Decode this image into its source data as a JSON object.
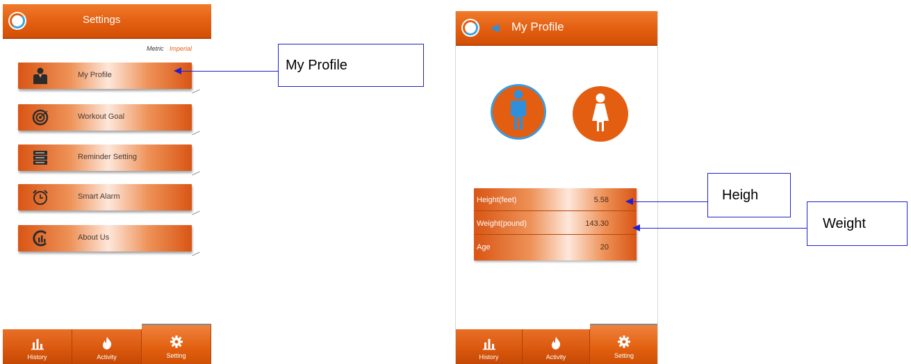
{
  "settings_screen": {
    "title": "Settings",
    "units": {
      "metric": "Metric",
      "imperial": "Imperial",
      "selected": "Imperial"
    },
    "menu": [
      {
        "label": "My Profile",
        "icon": "person-icon"
      },
      {
        "label": "Workout Goal",
        "icon": "target-icon"
      },
      {
        "label": "Reminder Setting",
        "icon": "list-icon"
      },
      {
        "label": "Smart Alarm",
        "icon": "alarm-clock-icon"
      },
      {
        "label": "About Us",
        "icon": "chart-logo-icon"
      }
    ]
  },
  "profile_screen": {
    "title": "My Profile",
    "gender": {
      "options": [
        "male",
        "female"
      ],
      "selected": "male"
    },
    "stats": [
      {
        "label": "Height(feet)",
        "value": "5.58"
      },
      {
        "label": "Weight(pound)",
        "value": "143.30"
      },
      {
        "label": "Age",
        "value": "20"
      }
    ]
  },
  "tabbar": {
    "tabs": [
      {
        "label": "History",
        "icon": "bar-chart-icon"
      },
      {
        "label": "Activity",
        "icon": "flame-icon"
      },
      {
        "label": "Setting",
        "icon": "gear-icon"
      }
    ],
    "active": "Setting"
  },
  "callouts": {
    "my_profile": "My Profile",
    "height": "Heigh",
    "weight": "Weight"
  },
  "colors": {
    "accent": "#e35e10",
    "selection_ring": "#3c9be0",
    "callout_border": "#1f1fd0"
  }
}
